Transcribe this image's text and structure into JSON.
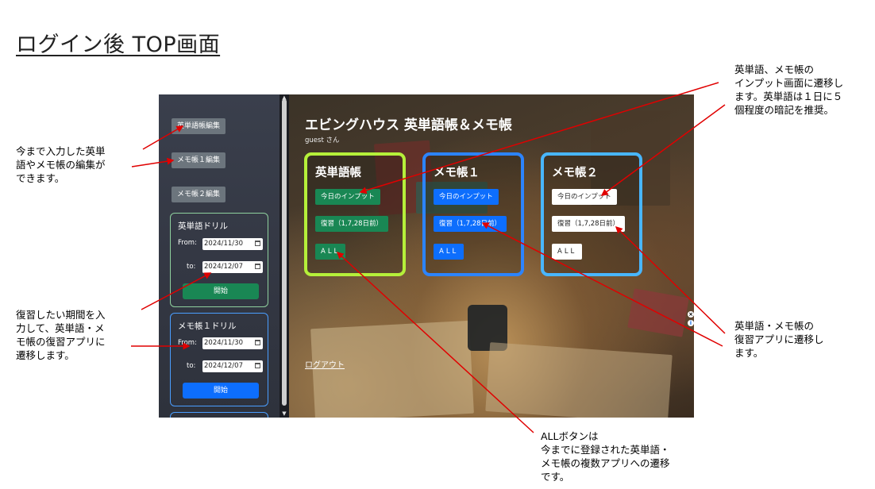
{
  "heading": "ログイン後 TOP画面",
  "annotations": {
    "top_right": "英単語、メモ帳の\nインプット画面に遷移し\nます。英単語は１日に５\n個程度の暗記を推奨。",
    "left_upper": "今まで入力した英単\n語やメモ帳の編集が\nできます。",
    "left_lower": "復習したい期間を入\n力して、英単語・メ\nモ帳の復習アプリに\n遷移します。",
    "right_middle": "英単語・メモ帳の\n復習アプリに遷移し\nます。",
    "bottom": "ALLボタンは\n今までに登録された英単語・\nメモ帳の複数アプリへの遷移\nです。"
  },
  "sidebar": {
    "btn_word_edit": "英単語帳編集",
    "btn_memo1_edit": "メモ帳１編集",
    "btn_memo2_edit": "メモ帳２編集",
    "drills": [
      {
        "title": "英単語ドリル",
        "from_label": "From:",
        "from": "2024/11/30",
        "to_label": "to:",
        "to": "2024/12/07",
        "start": "開始"
      },
      {
        "title": "メモ帳１ドリル",
        "from_label": "From:",
        "from": "2024/11/30",
        "to_label": "to:",
        "to": "2024/12/07",
        "start": "開始"
      }
    ]
  },
  "main": {
    "title": "エビングハウス 英単語帳＆メモ帳",
    "user": "guest さん",
    "cards": [
      {
        "title": "英単語帳",
        "input": "今日のインプット",
        "review": "復習（1,7,28日前）",
        "all": "ALL"
      },
      {
        "title": "メモ帳１",
        "input": "今日のインプット",
        "review": "復習（1,7,28日前）",
        "all": "ALL"
      },
      {
        "title": "メモ帳２",
        "input": "今日のインプット",
        "review": "復習（1,7,28日前）",
        "all": "ALL"
      }
    ],
    "logout": "ログアウト"
  },
  "colors": {
    "card1_border": "#b5f03a",
    "card2_border": "#2c84ff",
    "card3_border": "#48b6ff",
    "green_btn": "#198754",
    "blue_btn": "#0d6efd",
    "white_btn": "#ffffff",
    "arrow": "#e00000"
  }
}
